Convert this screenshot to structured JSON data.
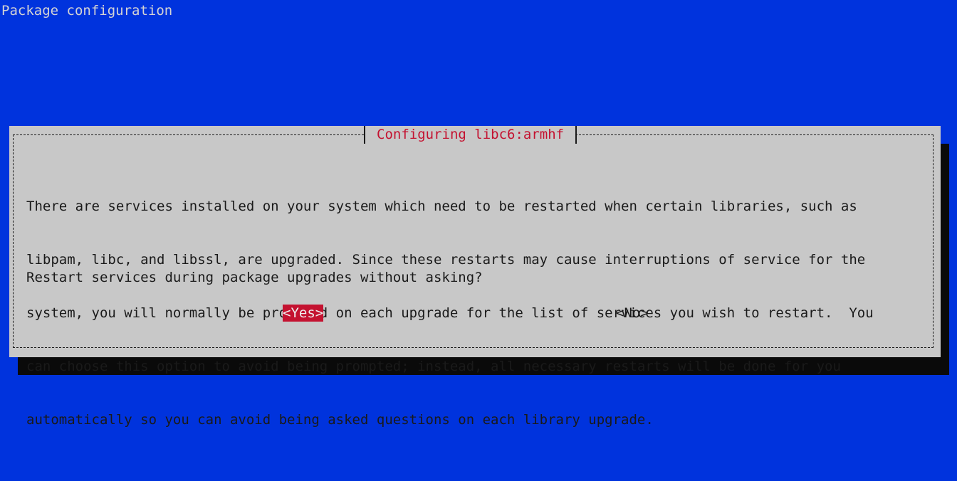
{
  "screen": {
    "title": "Package configuration"
  },
  "dialog": {
    "title": "Configuring libc6:armhf",
    "message_lines": [
      "There are services installed on your system which need to be restarted when certain libraries, such as",
      "libpam, libc, and libssl, are upgraded. Since these restarts may cause interruptions of service for the",
      "system, you will normally be prompted on each upgrade for the list of services you wish to restart.  You",
      "can choose this option to avoid being prompted; instead, all necessary restarts will be done for you",
      "automatically so you can avoid being asked questions on each library upgrade."
    ],
    "question": "Restart services during package upgrades without asking?",
    "buttons": {
      "yes": "<Yes>",
      "no": "<No>"
    },
    "selected_button": "yes"
  },
  "colors": {
    "background": "#0033dd",
    "dialog": "#c8c8c8",
    "shadow": "#0a0a0a",
    "accent": "#c41230",
    "text": "#1a1a1a",
    "title_text": "#d4d4d4"
  }
}
